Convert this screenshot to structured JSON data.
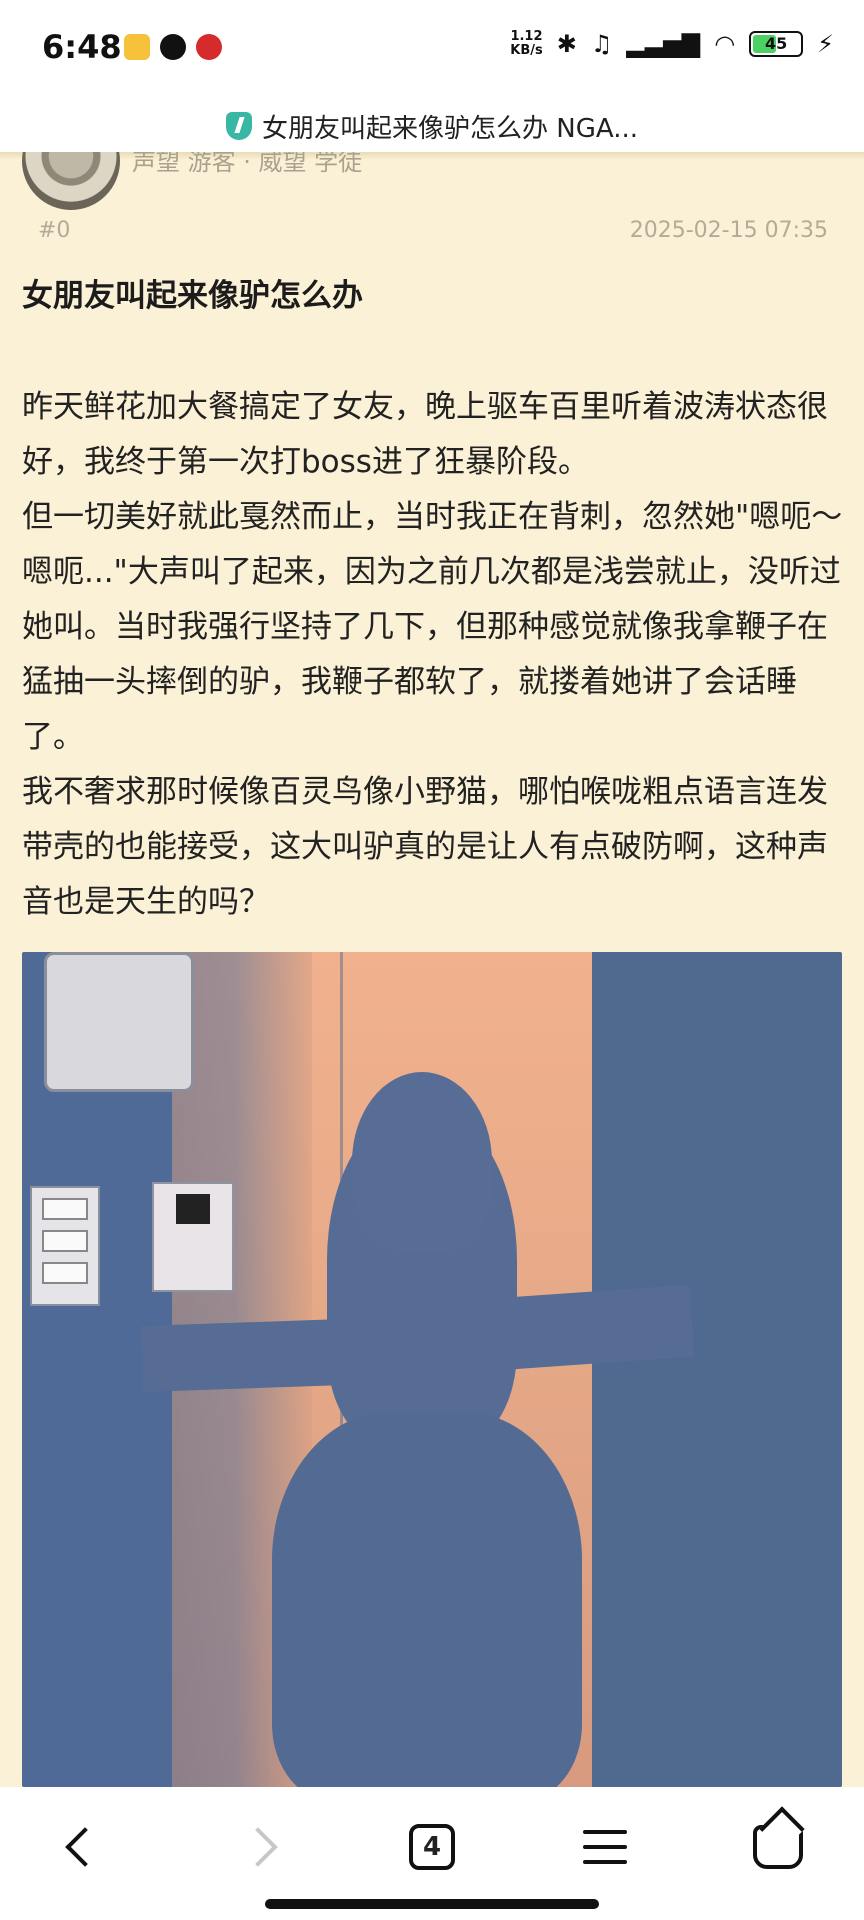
{
  "status_bar": {
    "time": "6:48",
    "network_speed_value": "1.12",
    "network_speed_unit": "KB/s",
    "battery_level": "45",
    "icons": [
      "notes-app-icon",
      "qq-icon",
      "bank-app-icon",
      "bluetooth-icon",
      "mute-icon",
      "hd-signal-icon",
      "wifi-icon",
      "battery-icon",
      "charging-icon"
    ]
  },
  "address_bar": {
    "title": "女朋友叫起来像驴怎么办 NGA...",
    "icon": "shield-check-icon"
  },
  "post": {
    "user_meta": "声望 游客 · 威望 学徒",
    "floor": "#0",
    "date": "2025-02-15 07:35",
    "title": "女朋友叫起来像驴怎么办",
    "paragraphs": [
      "昨天鲜花加大餐搞定了女友，晚上驱车百里听着波涛状态很好，我终于第一次打boss进了狂暴阶段。",
      "但一切美好就此戛然而止，当时我正在背刺，忽然她\"嗯呃～嗯呃...\"大声叫了起来，因为之前几次都是浅尝就止，没听过她叫。当时我强行坚持了几下，但那种感觉就像我拿鞭子在猛抽一头摔倒的驴，我鞭子都软了，就搂着她讲了会话睡了。",
      "我不奢求那时候像百灵鸟像小野猫，哪怕喉咙粗点语言连发带壳的也能接受，这大叫驴真的是让人有点破防啊，这种声音也是天生的吗？"
    ]
  },
  "bottom_nav": {
    "tab_count": "4",
    "items": [
      "back-icon",
      "forward-icon",
      "tabs-icon",
      "menu-icon",
      "home-icon"
    ]
  },
  "colors": {
    "page_background": "#fbf1d6",
    "accent": "#37b7a4",
    "battery": "#4cd263"
  }
}
